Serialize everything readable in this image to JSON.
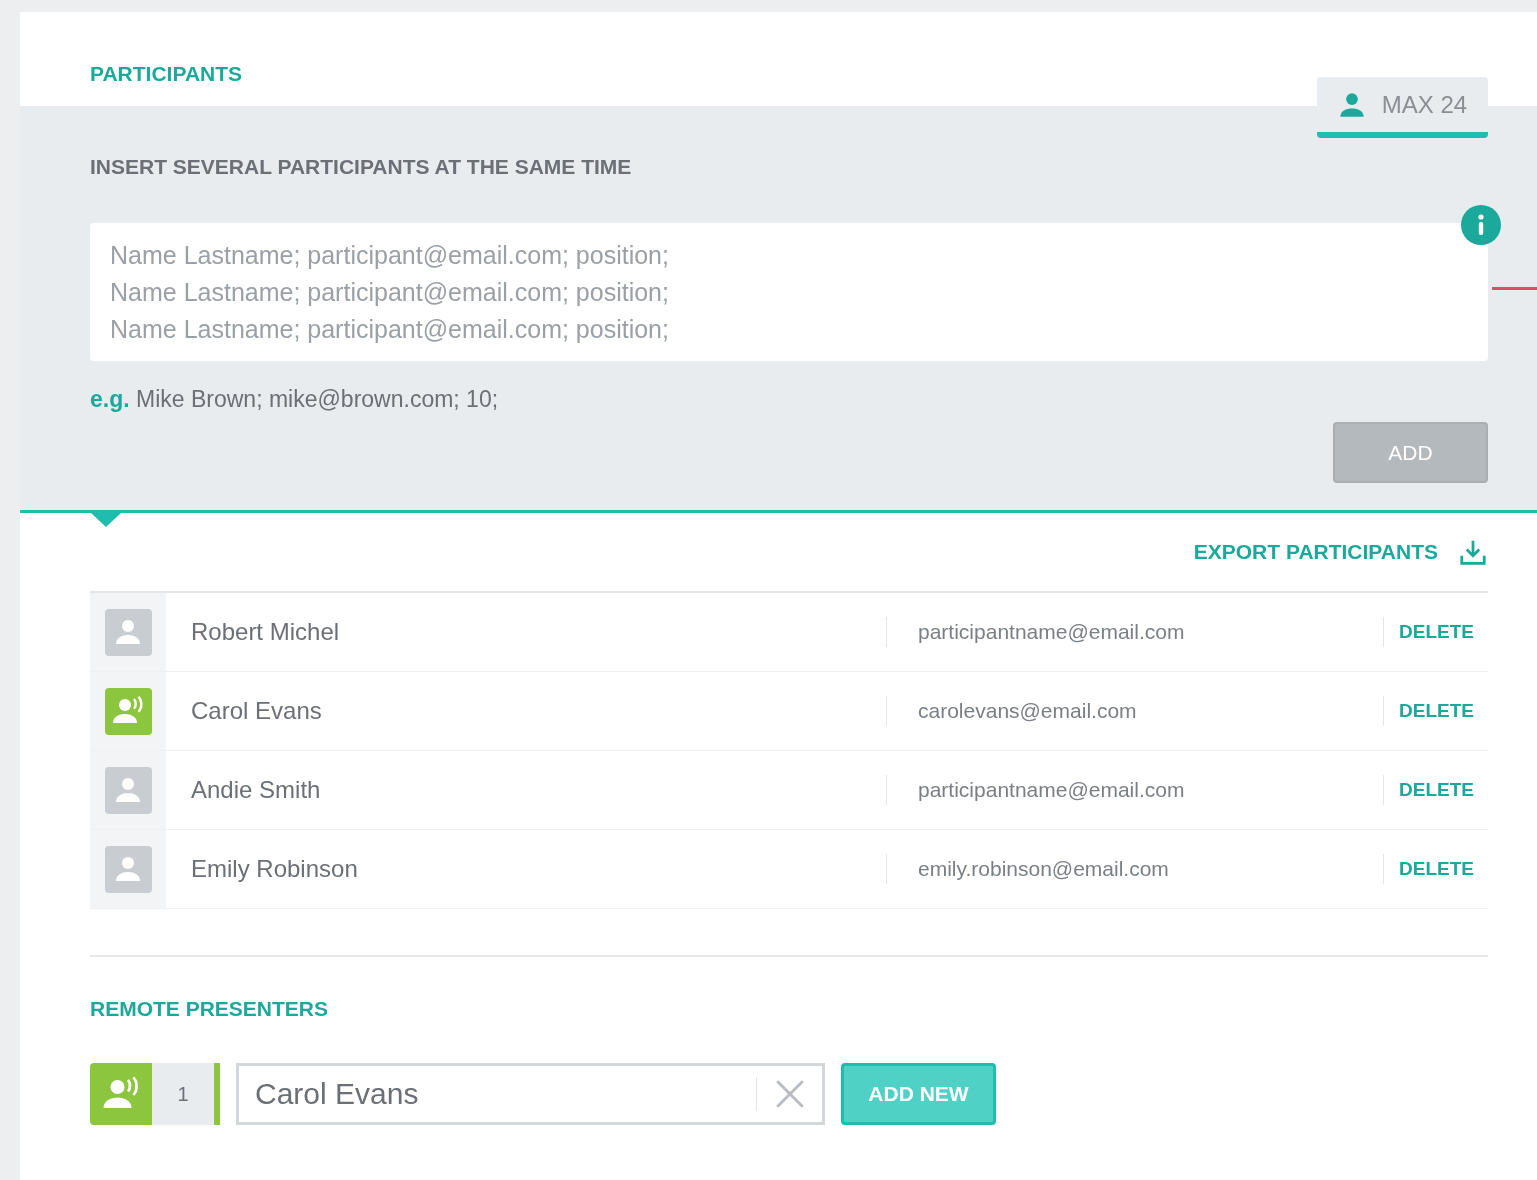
{
  "title": "PARTICIPANTS",
  "limit": {
    "label": "MAX 24"
  },
  "bulk_insert": {
    "label": "INSERT SEVERAL PARTICIPANTS AT THE SAME TIME",
    "placeholder": "Name Lastname; participant@email.com; position;\nName Lastname; participant@email.com; position;\nName Lastname; participant@email.com; position;",
    "example_prefix": "e.g.",
    "example": "Mike Brown; mike@brown.com; 10;",
    "add_button": {
      "label": "ADD",
      "disabled": true
    }
  },
  "export": {
    "label": "EXPORT PARTICIPANTS"
  },
  "participants": [
    {
      "name": "Robert Michel",
      "email": "participantname@email.com",
      "presenter": false,
      "action": "DELETE"
    },
    {
      "name": "Carol Evans",
      "email": "carolevans@email.com",
      "presenter": true,
      "action": "DELETE"
    },
    {
      "name": "Andie Smith",
      "email": "participantname@email.com",
      "presenter": false,
      "action": "DELETE"
    },
    {
      "name": "Emily Robinson",
      "email": "emily.robinson@email.com",
      "presenter": false,
      "action": "DELETE"
    }
  ],
  "remote_presenters": {
    "title": "REMOTE PRESENTERS",
    "items": [
      {
        "number": "1",
        "value": "Carol Evans"
      }
    ],
    "add_button": "ADD NEW"
  }
}
